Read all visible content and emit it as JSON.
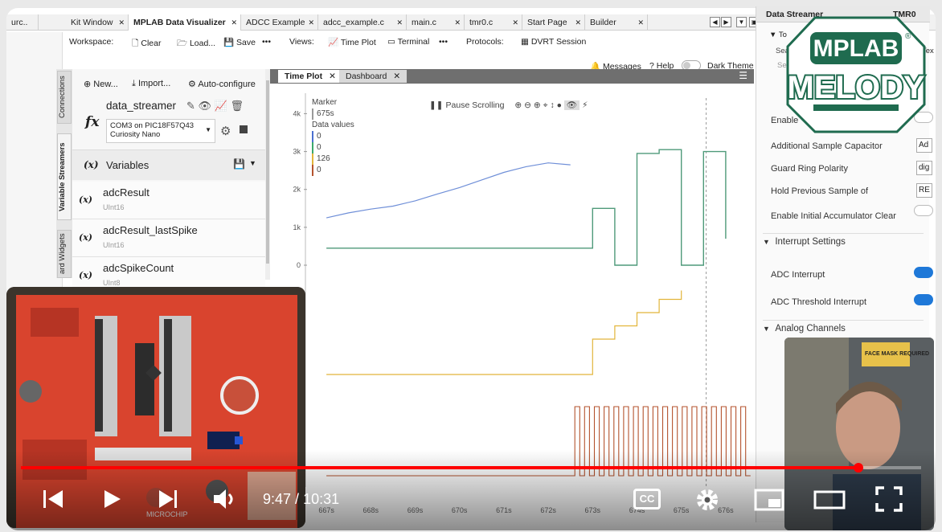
{
  "tabs": [
    {
      "label": "urc..",
      "x": 0,
      "w": 40
    },
    {
      "label": "Kit Window",
      "x": 74,
      "w": 78
    },
    {
      "label": "MPLAB Data Visualizer",
      "x": 152,
      "w": 140,
      "active": true
    },
    {
      "label": "ADCC Example",
      "x": 292,
      "w": 96
    },
    {
      "label": "adcc_example.c",
      "x": 388,
      "w": 110
    },
    {
      "label": "main.c",
      "x": 498,
      "w": 72
    },
    {
      "label": "tmr0.c",
      "x": 570,
      "w": 72
    },
    {
      "label": "Start Page",
      "x": 642,
      "w": 78
    },
    {
      "label": "Builder",
      "x": 720,
      "w": 78
    }
  ],
  "toolbar": {
    "workspace_label": "Workspace:",
    "clear": "Clear",
    "load": "Load...",
    "save": "Save",
    "more": "•••",
    "views_label": "Views:",
    "time_plot": "Time Plot",
    "terminal": "Terminal",
    "protocols_label": "Protocols:",
    "dvrt": "DVRT Session"
  },
  "subbar": {
    "messages": "Messages",
    "help": "Help",
    "dark_theme": "Dark Theme"
  },
  "side_tabs": [
    "Connections",
    "Variable Streamers",
    "ard Widgets"
  ],
  "left_panel": {
    "new": "New...",
    "import": "Import...",
    "autoconfigure": "Auto-configure",
    "streamer_name": "data_streamer",
    "port": "COM3 on PIC18F57Q43",
    "board": "Curiosity Nano",
    "variables_title": "Variables",
    "fx_symbol": "fx",
    "x_symbol": "(x)",
    "variables": [
      {
        "name": "adcResult",
        "type": "UInt16"
      },
      {
        "name": "adcResult_lastSpike",
        "type": "UInt16"
      },
      {
        "name": "adcSpikeCount",
        "type": "UInt8"
      }
    ]
  },
  "plot": {
    "tabs": [
      "Time Plot",
      "Dashboard"
    ],
    "pause_scrolling": "Pause Scrolling",
    "marker_title": "Marker",
    "marker_value": "675s",
    "data_values_title": "Data values",
    "data_values": [
      {
        "value": "0",
        "color": "#4a6fd0"
      },
      {
        "value": "0",
        "color": "#3aa86a"
      },
      {
        "value": "126",
        "color": "#e2b53a"
      },
      {
        "value": "0",
        "color": "#b4532e"
      }
    ],
    "y_ticks": [
      "4k",
      "3k",
      "2k",
      "1k",
      "0"
    ],
    "x_ticks": [
      "667s",
      "668s",
      "669s",
      "670s",
      "671s",
      "672s",
      "673s",
      "674s",
      "675s",
      "676s"
    ]
  },
  "right_panel": {
    "tabs": [
      "Data Streamer",
      "TMR0"
    ],
    "truncated_labels": [
      "To",
      "Sear",
      "Sea",
      "Tex"
    ],
    "labels": [
      {
        "text": "Enable",
        "y": 136
      },
      {
        "text": "Additional Sample Capacitor",
        "y": 168
      },
      {
        "text": "Guard Ring Polarity",
        "y": 196
      },
      {
        "text": "Hold Previous Sample of",
        "y": 224
      },
      {
        "text": "Enable Initial Accumulator Clear",
        "y": 255
      },
      {
        "text": "ADC Interrupt",
        "y": 328
      },
      {
        "text": "ADC Threshold Interrupt",
        "y": 362
      }
    ],
    "inputs": [
      {
        "text": "Ad",
        "y": 166
      },
      {
        "text": "dig",
        "y": 194
      },
      {
        "text": "RE",
        "y": 222
      }
    ],
    "sections": [
      {
        "text": "Interrupt Settings",
        "y": 286
      },
      {
        "text": "Analog Channels",
        "y": 394
      }
    ]
  },
  "logo": {
    "line1": "MPLAB",
    "line2": "MELODY",
    "reg": "®"
  },
  "webcam_sign": "FACE MASK REQUIRED",
  "board_label": "MICROCHIP",
  "player": {
    "current_time": "9:47",
    "separator": " / ",
    "duration": "10:31",
    "progress_fraction": 0.93,
    "cc_label": "CC"
  },
  "chart_data": {
    "type": "line",
    "x_ticks": [
      "667s",
      "668s",
      "669s",
      "670s",
      "671s",
      "672s",
      "673s",
      "674s",
      "675s",
      "676s"
    ],
    "y_ticks": [
      "4k",
      "3k",
      "2k",
      "1k",
      "0"
    ],
    "x": [
      667,
      667.5,
      668,
      668.5,
      669,
      669.5,
      670,
      670.5,
      671,
      671.5,
      672,
      672.5,
      673,
      673.5,
      674,
      674.5,
      675,
      675.5,
      676
    ],
    "ylim": [
      0,
      4200
    ],
    "xlim": [
      666.6,
      676.6
    ],
    "marker_x": 675,
    "series": [
      {
        "color": "#6f8fd8",
        "values": [
          1250,
          1380,
          1480,
          1560,
          1700,
          1880,
          2050,
          2250,
          2450,
          2600,
          2700,
          2650,
          null,
          null,
          null,
          null,
          null,
          null,
          null
        ]
      },
      {
        "color": "#4f9a7a",
        "values": [
          450,
          450,
          450,
          450,
          450,
          450,
          450,
          450,
          450,
          450,
          450,
          450,
          1500,
          0,
          2950,
          3050,
          0,
          3000,
          700
        ]
      },
      {
        "color": "#e2b53a",
        "values": [
          0,
          0,
          0,
          0,
          0,
          0,
          0,
          0,
          0,
          0,
          0,
          0,
          80,
          110,
          140,
          170,
          190,
          null,
          null
        ]
      },
      {
        "color": "#b4532e",
        "values": [
          0,
          0,
          0,
          0,
          0,
          0,
          0,
          0,
          0,
          0,
          0,
          0,
          1,
          1,
          1,
          1,
          1,
          1,
          1
        ]
      }
    ]
  }
}
